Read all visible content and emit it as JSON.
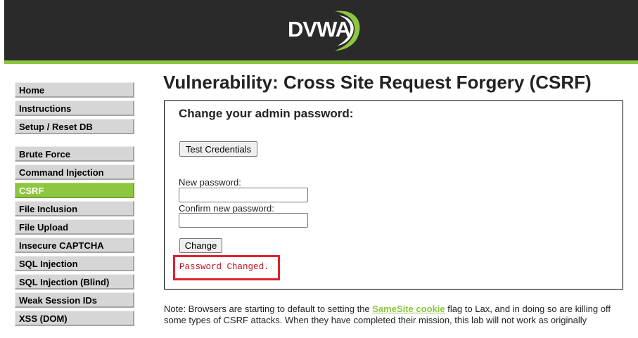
{
  "header": {
    "logo_text": "DVWA",
    "colors": {
      "background": "#2a2a2a",
      "accent": "#8dc63f"
    }
  },
  "menu": {
    "groups": [
      {
        "items": [
          {
            "label": "Home"
          },
          {
            "label": "Instructions"
          },
          {
            "label": "Setup / Reset DB"
          }
        ]
      },
      {
        "items": [
          {
            "label": "Brute Force"
          },
          {
            "label": "Command Injection"
          },
          {
            "label": "CSRF",
            "selected": true
          },
          {
            "label": "File Inclusion"
          },
          {
            "label": "File Upload"
          },
          {
            "label": "Insecure CAPTCHA"
          },
          {
            "label": "SQL Injection"
          },
          {
            "label": "SQL Injection (Blind)"
          },
          {
            "label": "Weak Session IDs"
          },
          {
            "label": "XSS (DOM)"
          }
        ]
      }
    ]
  },
  "main": {
    "title": "Vulnerability: Cross Site Request Forgery (CSRF)",
    "form": {
      "heading": "Change your admin password:",
      "test_button": "Test Credentials",
      "new_password_label": "New password:",
      "new_password_value": "",
      "confirm_password_label": "Confirm new password:",
      "confirm_password_value": "",
      "change_button": "Change",
      "message": "Password Changed."
    },
    "note": {
      "before": "Note: Browsers are starting to default to setting the ",
      "link": "SameSite cookie",
      "after": " flag to Lax, and in doing so are killing off some types of CSRF attacks. When they have completed their mission, this lab will not work as originally"
    }
  }
}
